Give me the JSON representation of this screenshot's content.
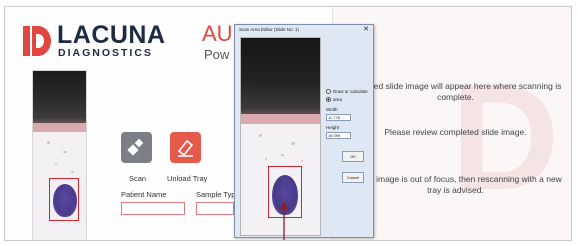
{
  "header": {
    "brand_name": "LACUNA",
    "brand_sub": "DIAGNOSTICS",
    "app_title_partial": "AU",
    "app_sub_partial": "Pow"
  },
  "toolbar": {
    "scan_label": "Scan",
    "unload_label": "Unload Tray"
  },
  "form": {
    "patient_name_label": "Patient Name",
    "sample_type_label": "Sample Typ"
  },
  "dialog": {
    "title": "Scan Area Editor (Slide No: 1)",
    "close_glyph": "✕",
    "radio_options": [
      "Draw or calculate",
      "area"
    ],
    "selected_option": "area",
    "width_label": "Width",
    "width_value": "11.776",
    "height_label": "Height",
    "height_value": "16.099",
    "ok_label": "OK",
    "cancel_label": "Cancel"
  },
  "right_panel": {
    "message_1": "Scanned slide image will appear here where scanning is complete.",
    "message_2": "Please review completed slide image.",
    "message_3": "If slide image is out of focus, then rescanning with a new tray is advised."
  },
  "colors": {
    "brand_dark": "#1f2a44",
    "accent_red": "#e0473f",
    "scan_button": "#7c7f86",
    "unload_button": "#e55a4c",
    "dialog_bg": "#dfe9f5",
    "arrow": "#8b1c2a"
  }
}
